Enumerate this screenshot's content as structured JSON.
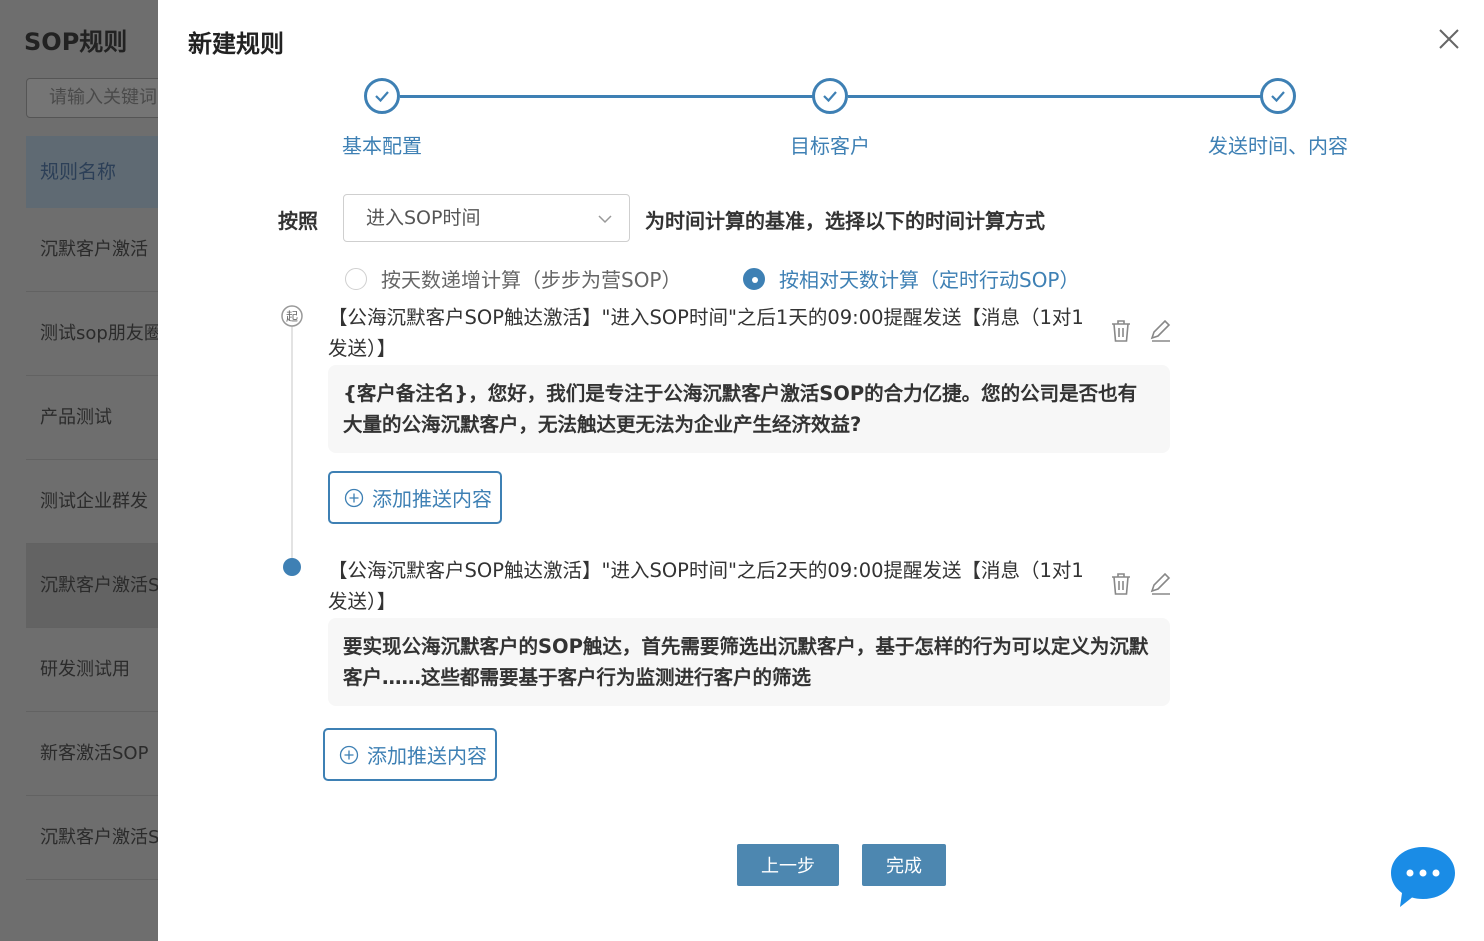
{
  "background": {
    "title": "SOP规则",
    "search_placeholder": "请输入关键词",
    "table_header": "规则名称",
    "rows": [
      "沉默客户激活",
      "测试sop朋友圈",
      "产品测试",
      "测试企业群发",
      "沉默客户激活SOP",
      "研发测试用",
      "新客激活SOP",
      "沉默客户激活SOP"
    ]
  },
  "modal": {
    "title": "新建规则",
    "steps": [
      {
        "label": "基本配置",
        "status": "done"
      },
      {
        "label": "目标客户",
        "status": "done"
      },
      {
        "label": "发送时间、内容",
        "status": "done"
      }
    ],
    "criteria": {
      "prefix": "按照",
      "select_value": "进入SOP时间",
      "suffix": "为时间计算的基准，选择以下的时间计算方式"
    },
    "radios": [
      {
        "label": "按天数递增计算（步步为营SOP）",
        "checked": false
      },
      {
        "label": "按相对天数计算（定时行动SOP）",
        "checked": true
      }
    ],
    "timeline_items": [
      {
        "header": "【公海沉默客户SOP触达激活】\"进入SOP时间\"之后1天的09:00提醒发送【消息（1对1发送）】",
        "content": "{客户备注名}，您好，我们是专注于公海沉默客户激活SOP的合力亿捷。您的公司是否也有大量的公海沉默客户，无法触达更无法为企业产生经济效益?",
        "add_label": "添加推送内容"
      },
      {
        "header": "【公海沉默客户SOP触达激活】\"进入SOP时间\"之后2天的09:00提醒发送【消息（1对1发送）】",
        "content": "要实现公海沉默客户的SOP触达，首先需要筛选出沉默客户，基于怎样的行为可以定义为沉默客户……这些都需要基于客户行为监测进行客户的筛选",
        "add_label": "添加推送内容"
      }
    ],
    "buttons": {
      "prev": "上一步",
      "finish": "完成"
    },
    "timeline_start_glyph": "起"
  },
  "colors": {
    "accent": "#3e80b4",
    "button": "#4d87b0",
    "chat": "#1a8ce6"
  }
}
